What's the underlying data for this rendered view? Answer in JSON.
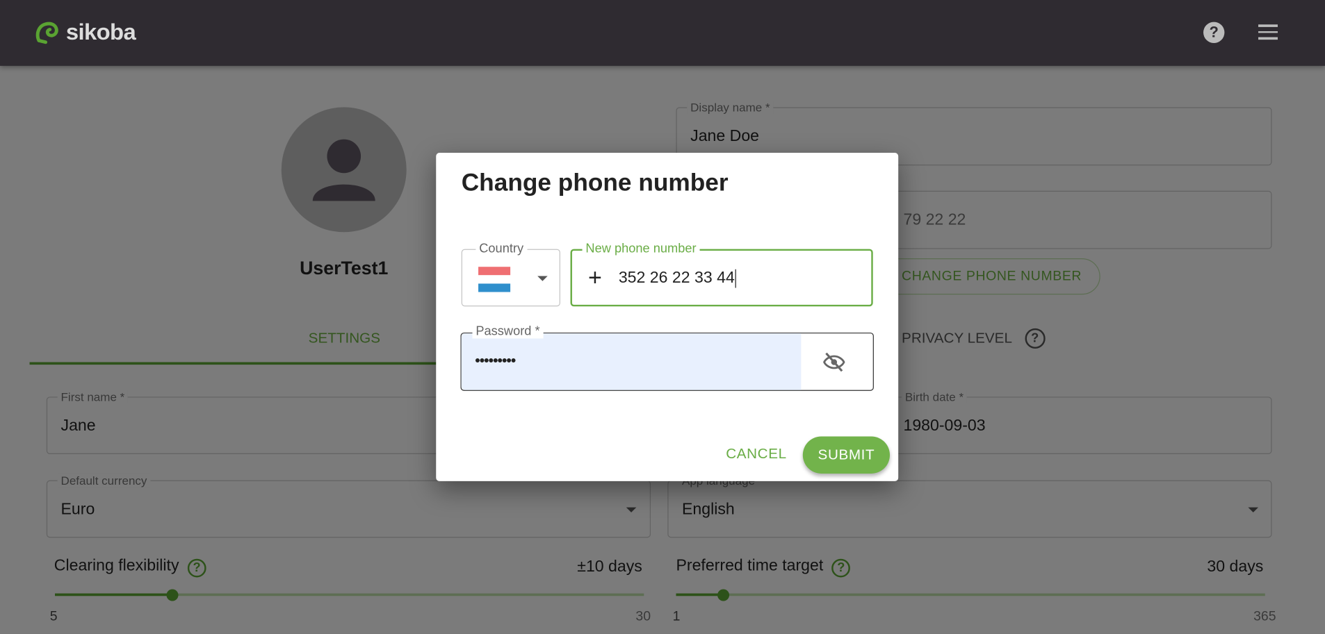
{
  "header": {
    "brand": "sikoba",
    "help_icon": "help-circle-icon",
    "menu_icon": "hamburger-menu-icon",
    "bg_color": "#2f2b31"
  },
  "profile": {
    "username": "UserTest1",
    "avatar_icon": "person-icon"
  },
  "tabs": [
    {
      "label": "SETTINGS",
      "active": true
    },
    {
      "label": "PRIVACY LEVEL",
      "active": false
    }
  ],
  "fields": {
    "display_name": {
      "label": "Display name *",
      "value": "Jane Doe"
    },
    "phone": {
      "value": "79 22 22"
    },
    "change_phone_button": "CHANGE PHONE NUMBER",
    "first_name": {
      "label": "First name *",
      "value": "Jane"
    },
    "birth_date": {
      "label": "Birth date *",
      "value": "1980-09-03"
    },
    "default_currency": {
      "label": "Default currency",
      "value": "Euro"
    },
    "app_language": {
      "label": "App language",
      "value": "English"
    }
  },
  "sliders": {
    "clearing": {
      "label": "Clearing flexibility",
      "value_text": "±10 days",
      "min": 5,
      "max": 30,
      "value": 10,
      "min_label": "5",
      "max_label": "30"
    },
    "time_target": {
      "label": "Preferred time target",
      "value_text": "30 days",
      "min": 1,
      "max": 365,
      "value": 30,
      "min_label": "1",
      "max_label": "365"
    }
  },
  "dialog": {
    "title": "Change phone number",
    "country_label": "Country",
    "country_flag": "Luxembourg",
    "phone_label": "New phone number",
    "phone_prefix": "+",
    "phone_value": "352 26 22 33 44",
    "password_label": "Password *",
    "password_value": "•••••••••",
    "visibility_icon": "eye-off-icon",
    "cancel": "CANCEL",
    "submit": "SUBMIT"
  },
  "colors": {
    "accent": "#6aad46",
    "autofill": "#e8f0fe"
  }
}
